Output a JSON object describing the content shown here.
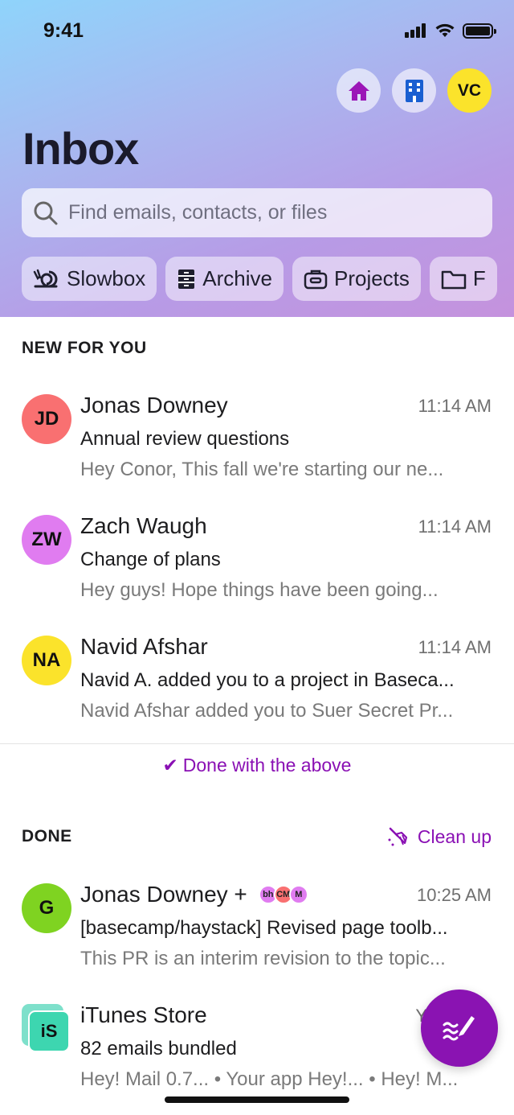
{
  "status": {
    "time": "9:41"
  },
  "header": {
    "title": "Inbox",
    "avatar_initials": "VC",
    "search_placeholder": "Find emails, contacts, or files"
  },
  "chips": [
    {
      "label": "Slowbox",
      "icon": "snail-icon"
    },
    {
      "label": "Archive",
      "icon": "archive-icon"
    },
    {
      "label": "Projects",
      "icon": "briefcase-icon"
    },
    {
      "label": "F",
      "icon": "folder-icon"
    }
  ],
  "new_section": {
    "label": "NEW FOR YOU",
    "items": [
      {
        "initials": "JD",
        "color": "#f97071",
        "sender": "Jonas Downey",
        "time": "11:14 AM",
        "subject": "Annual review questions",
        "preview": "Hey Conor, This fall we're starting our ne..."
      },
      {
        "initials": "ZW",
        "color": "#e07cf0",
        "sender": "Zach Waugh",
        "time": "11:14 AM",
        "subject": "Change of plans",
        "preview": "Hey guys! Hope things have been going..."
      },
      {
        "initials": "NA",
        "color": "#fbe32b",
        "sender": "Navid Afshar",
        "time": "11:14 AM",
        "subject": "Navid A. added you to a project in Baseca...",
        "preview": "Navid Afshar added you to Suer Secret Pr..."
      }
    ]
  },
  "done_with_above": "Done with the above",
  "done_section": {
    "label": "DONE",
    "cleanup_label": "Clean up",
    "items": [
      {
        "initials": "G",
        "color": "#7fd321",
        "sender": "Jonas Downey +",
        "participants": [
          {
            "initials": "bh",
            "color": "#e07cf0"
          },
          {
            "initials": "CM",
            "color": "#f97071"
          },
          {
            "initials": "M",
            "color": "#e07cf0"
          }
        ],
        "time": "10:25 AM",
        "subject": "[basecamp/haystack] Revised page toolb...",
        "preview": "This PR is an interim revision to the topic..."
      },
      {
        "initials": "iS",
        "color": "#3dd6b0",
        "sender": "iTunes Store",
        "time": "Y",
        "subject": "82 emails bundled",
        "preview": "Hey! Mail 0.7... • Your app Hey!... • Hey! M..."
      }
    ]
  },
  "colors": {
    "accent": "#8a13b2"
  }
}
